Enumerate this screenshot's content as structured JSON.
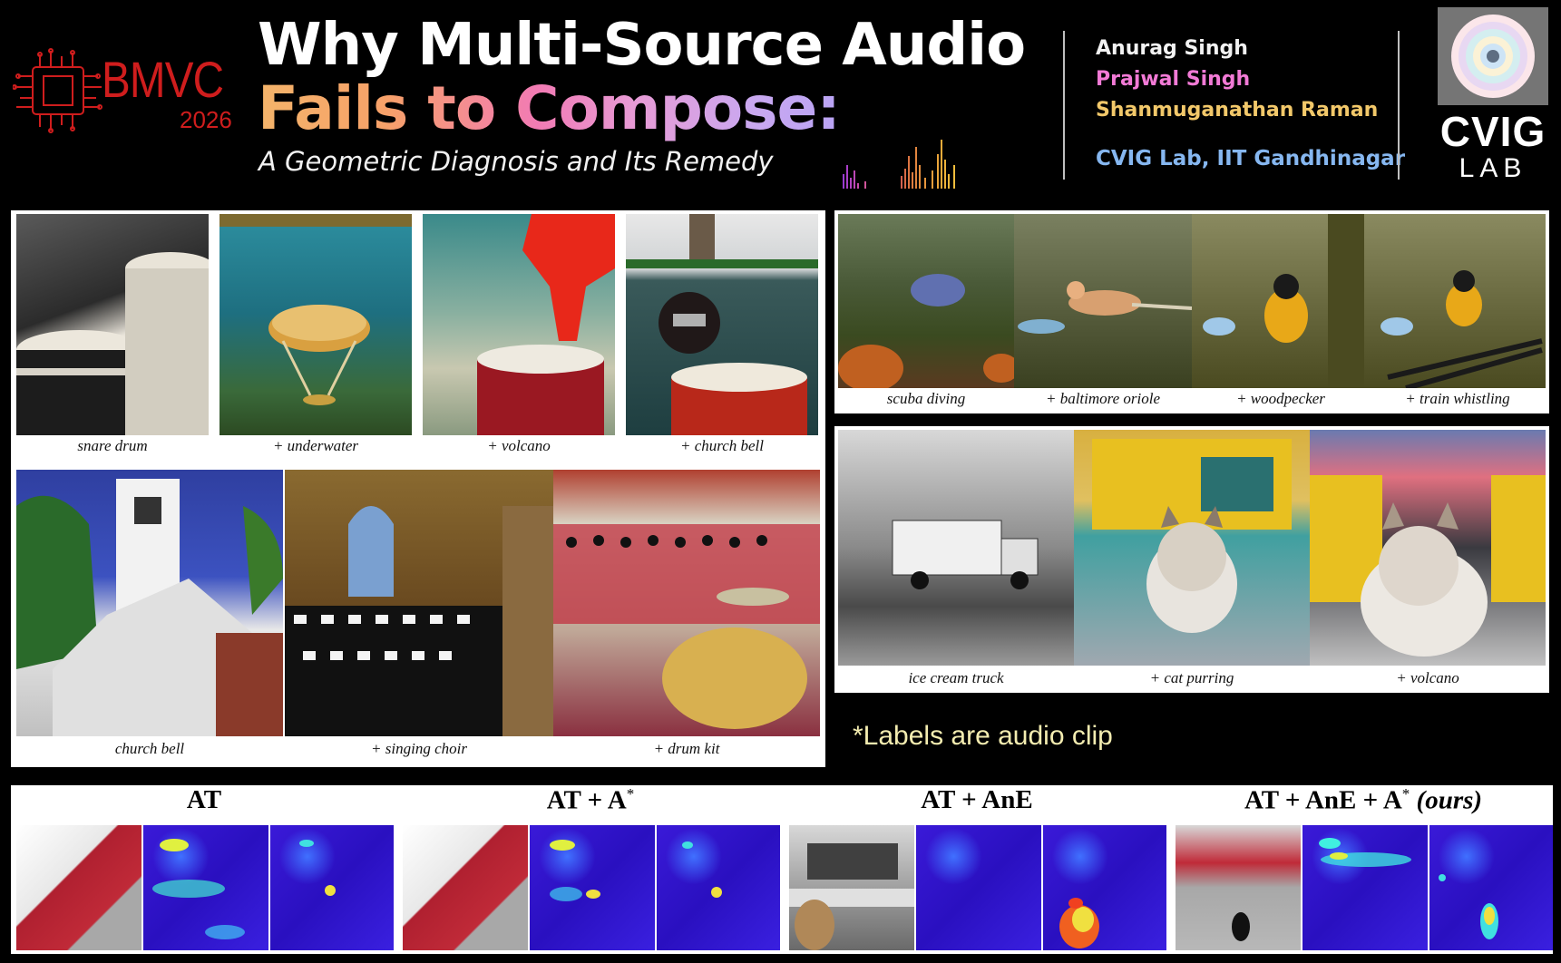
{
  "header": {
    "conference": "BMVC",
    "year": "2026",
    "title_line1": "Why Multi-Source Audio",
    "title_line2": "Fails to Compose:",
    "subtitle": "A Geometric Diagnosis and Its Remedy",
    "authors": [
      "Anurag Singh",
      "Prajwal Singh",
      "Shanmuganathan Raman"
    ],
    "affiliation": "CVIG Lab, IIT Gandhinagar",
    "lab_logo_top": "CVIG",
    "lab_logo_bottom": "LAB"
  },
  "panel_a": {
    "row1_captions": [
      "snare drum",
      "+ underwater",
      "+ volcano",
      "+ church bell"
    ],
    "row2_captions": [
      "church bell",
      "+ singing choir",
      "+ drum kit"
    ]
  },
  "panel_b": {
    "captions": [
      "scuba diving",
      "+ baltimore oriole",
      "+ woodpecker",
      "+ train whistling"
    ]
  },
  "panel_c": {
    "captions": [
      "ice cream truck",
      "+ cat purring",
      "+ volcano"
    ]
  },
  "note": "*Labels are audio clip",
  "heatmap_panel": {
    "methods": [
      {
        "name": "AT",
        "sup": "",
        "suffix": ""
      },
      {
        "name": "AT + A",
        "sup": "*",
        "suffix": ""
      },
      {
        "name": "AT + AnE",
        "sup": "",
        "suffix": ""
      },
      {
        "name": "AT + AnE + A",
        "sup": "*",
        "suffix": "(ours)"
      }
    ]
  },
  "colors": {
    "bmvc_red": "#cf1d1d",
    "author2_pink": "#f27ad6",
    "author3_gold": "#f2c86a",
    "affiliation_blue": "#86b7f0",
    "note_yellow": "#f3ecb0"
  }
}
